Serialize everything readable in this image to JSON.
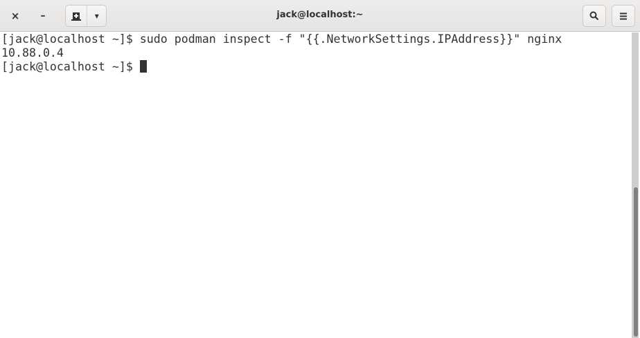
{
  "window": {
    "title": "jack@localhost:~"
  },
  "header": {
    "close_icon": "×",
    "minimize_icon": "–",
    "new_tab_icon": "new-tab-icon",
    "dropdown_icon": "▾",
    "search_icon": "search-icon",
    "menu_icon": "≡"
  },
  "terminal": {
    "lines": [
      "[jack@localhost ~]$ sudo podman inspect -f \"{{.NetworkSettings.IPAddress}}\" nginx",
      "10.88.0.4",
      "[jack@localhost ~]$ "
    ]
  },
  "scrollbar": {
    "position_fraction": 1.0,
    "visible_fraction": 0.49
  }
}
